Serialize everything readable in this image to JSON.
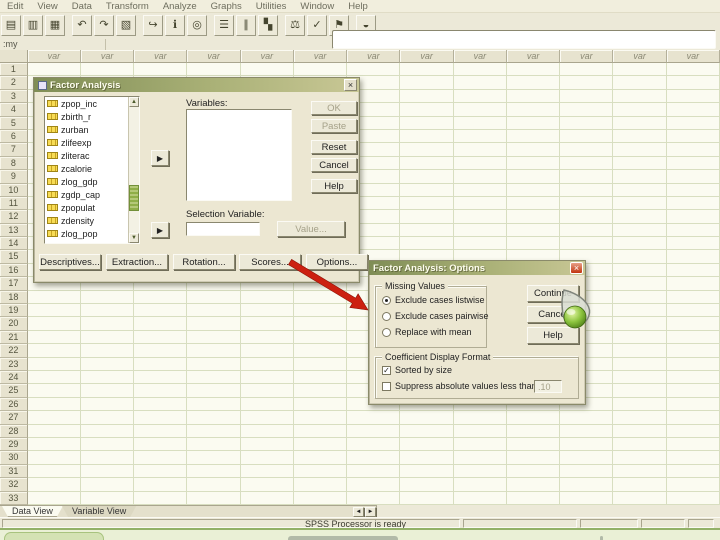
{
  "menu_bar": {
    "items": [
      "Edit",
      "View",
      "Data",
      "Transform",
      "Analyze",
      "Graphs",
      "Utilities",
      "Window",
      "Help"
    ]
  },
  "toolbar": {
    "icons": [
      {
        "name": "save-icon",
        "glyph": "▤"
      },
      {
        "name": "print-icon",
        "glyph": "▥"
      },
      {
        "name": "dialog-recall-icon",
        "glyph": "▦"
      },
      {
        "name": "undo-icon",
        "glyph": "↶"
      },
      {
        "name": "redo-icon",
        "glyph": "↷"
      },
      {
        "name": "goto-chart-icon",
        "glyph": "▧"
      },
      {
        "name": "goto-case-icon",
        "glyph": "↪"
      },
      {
        "name": "variable-info-icon",
        "glyph": "ℹ"
      },
      {
        "name": "find-icon",
        "glyph": "◎"
      },
      {
        "name": "insert-cases-icon",
        "glyph": "☰"
      },
      {
        "name": "insert-variable-icon",
        "glyph": "∥"
      },
      {
        "name": "split-file-icon",
        "glyph": "▚"
      },
      {
        "name": "weight-cases-icon",
        "glyph": "⚖"
      },
      {
        "name": "select-cases-icon",
        "glyph": "✓"
      },
      {
        "name": "value-labels-icon",
        "glyph": "⚑"
      },
      {
        "name": "use-sets-icon",
        "glyph": "◒"
      }
    ]
  },
  "cell_editor": {
    "reference": ":my",
    "value": ""
  },
  "grid": {
    "column_header_label": "var",
    "column_count": 13,
    "row_numbers": [
      1,
      2,
      3,
      4,
      5,
      6,
      7,
      8,
      9,
      10,
      11,
      12,
      13,
      14,
      15,
      16,
      17,
      18,
      19,
      20,
      21,
      22,
      23,
      24,
      25,
      26,
      27,
      28,
      29,
      30,
      31,
      32,
      33
    ]
  },
  "factor_dialog": {
    "title": "Factor Analysis",
    "source_variables": [
      "zpop_inc",
      "zbirth_r",
      "zurban",
      "zlifeexp",
      "zliterac",
      "zcalorie",
      "zlog_gdp",
      "zgdp_cap",
      "zpopulat",
      "zdensity",
      "zlog_pop"
    ],
    "variables_label": "Variables:",
    "selection_label": "Selection Variable:",
    "selection_value": "",
    "buttons": {
      "ok": "OK",
      "paste": "Paste",
      "reset": "Reset",
      "cancel": "Cancel",
      "help": "Help",
      "value": "Value..."
    },
    "bottom_buttons": [
      "Descriptives...",
      "Extraction...",
      "Rotation...",
      "Scores...",
      "Options..."
    ]
  },
  "options_dialog": {
    "title": "Factor Analysis: Options",
    "missing_values": {
      "label": "Missing Values",
      "options": [
        {
          "label": "Exclude cases listwise",
          "selected": true
        },
        {
          "label": "Exclude cases pairwise",
          "selected": false
        },
        {
          "label": "Replace with mean",
          "selected": false
        }
      ]
    },
    "coefficient_format": {
      "label": "Coefficient Display Format",
      "sorted_by_size": {
        "label": "Sorted by size",
        "checked": true
      },
      "suppress": {
        "label": "Suppress absolute values less than:",
        "checked": false,
        "value": ".10"
      }
    },
    "buttons": {
      "continue": "Continue",
      "cancel": "Cancel",
      "help": "Help"
    }
  },
  "tabs": {
    "data_view": "Data View",
    "variable_view": "Variable View"
  },
  "status_bar": {
    "message": "SPSS Processor is ready"
  },
  "colors": {
    "annotation_arrow": "#cc2010",
    "cursor_orb": "#7cb82e",
    "titlebar_olive": "#8a9a60"
  }
}
